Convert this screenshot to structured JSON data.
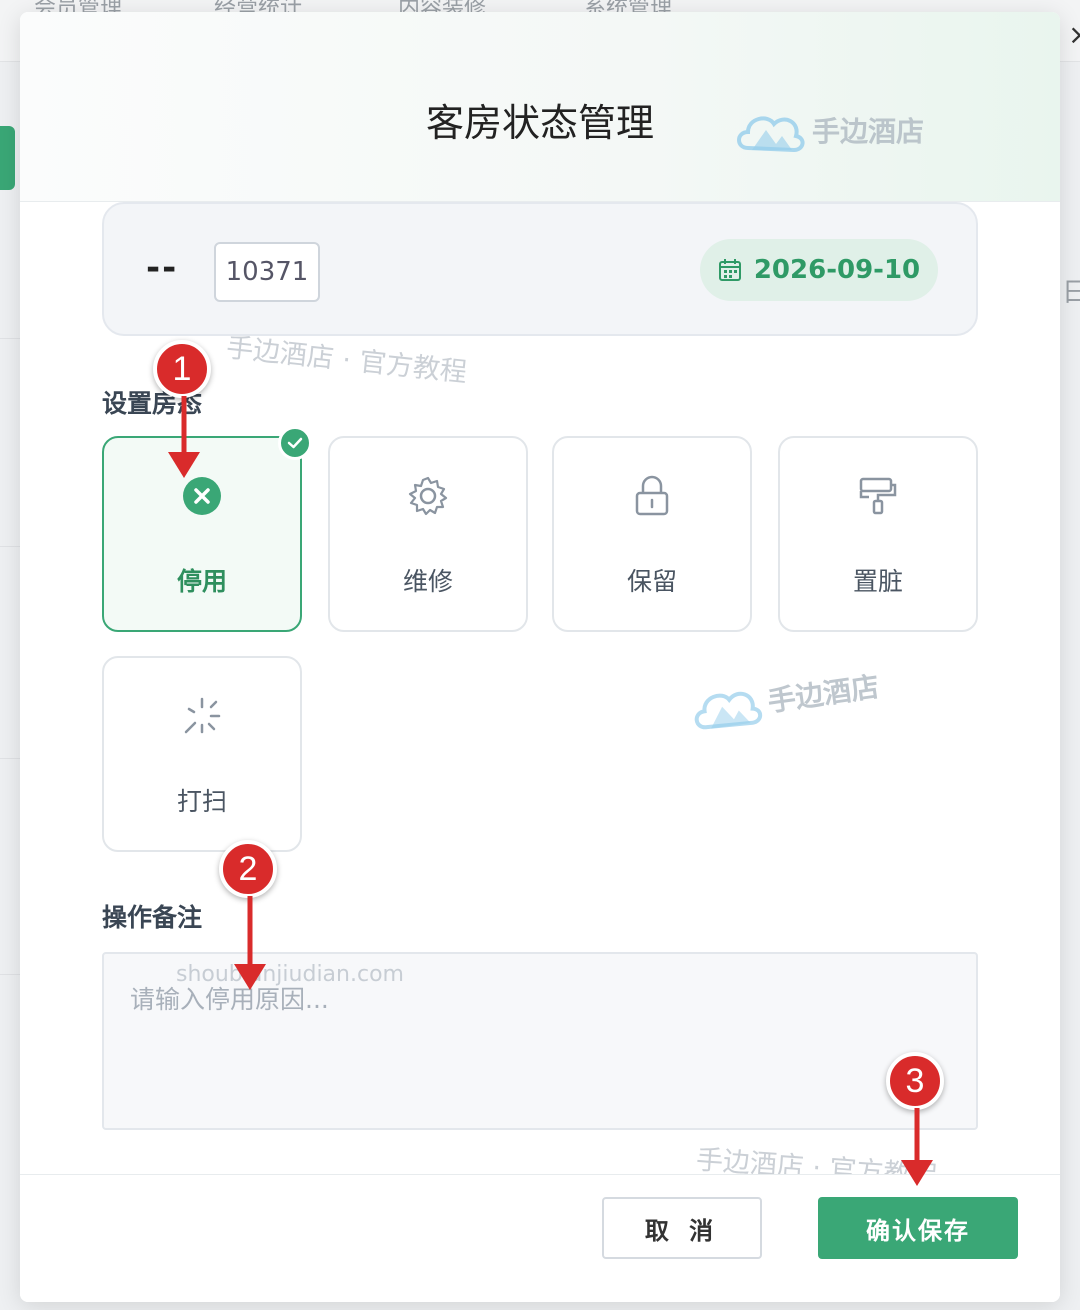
{
  "background": {
    "nav_items": [
      "会员管理",
      "经营统计",
      "内容装修",
      "系统管理"
    ],
    "right_edge_char": "日"
  },
  "modal": {
    "title": "客房状态管理",
    "brand_watermark": "手边酒店",
    "room": {
      "type_placeholder": "--",
      "number": "10371",
      "date": "2026-09-10"
    },
    "status_section_label": "设置房态",
    "status_options": [
      {
        "label": "停用",
        "icon": "x-circle-icon",
        "selected": true
      },
      {
        "label": "维修",
        "icon": "gear-icon",
        "selected": false
      },
      {
        "label": "保留",
        "icon": "lock-icon",
        "selected": false
      },
      {
        "label": "置脏",
        "icon": "paint-roller-icon",
        "selected": false
      },
      {
        "label": "打扫",
        "icon": "sparkle-icon",
        "selected": false
      }
    ],
    "note_section_label": "操作备注",
    "note_placeholder": "请输入停用原因...",
    "note_value": "",
    "cancel_label": "取 消",
    "confirm_label": "确认保存",
    "watermark_texts": [
      "手边酒店 · 官方教程",
      "shoubianjiudian.com",
      "手边酒店 · 官方教程"
    ]
  },
  "annotations": [
    "1",
    "2",
    "3"
  ],
  "colors": {
    "accent": "#3aa776",
    "annotation_red": "#d92b2b"
  }
}
